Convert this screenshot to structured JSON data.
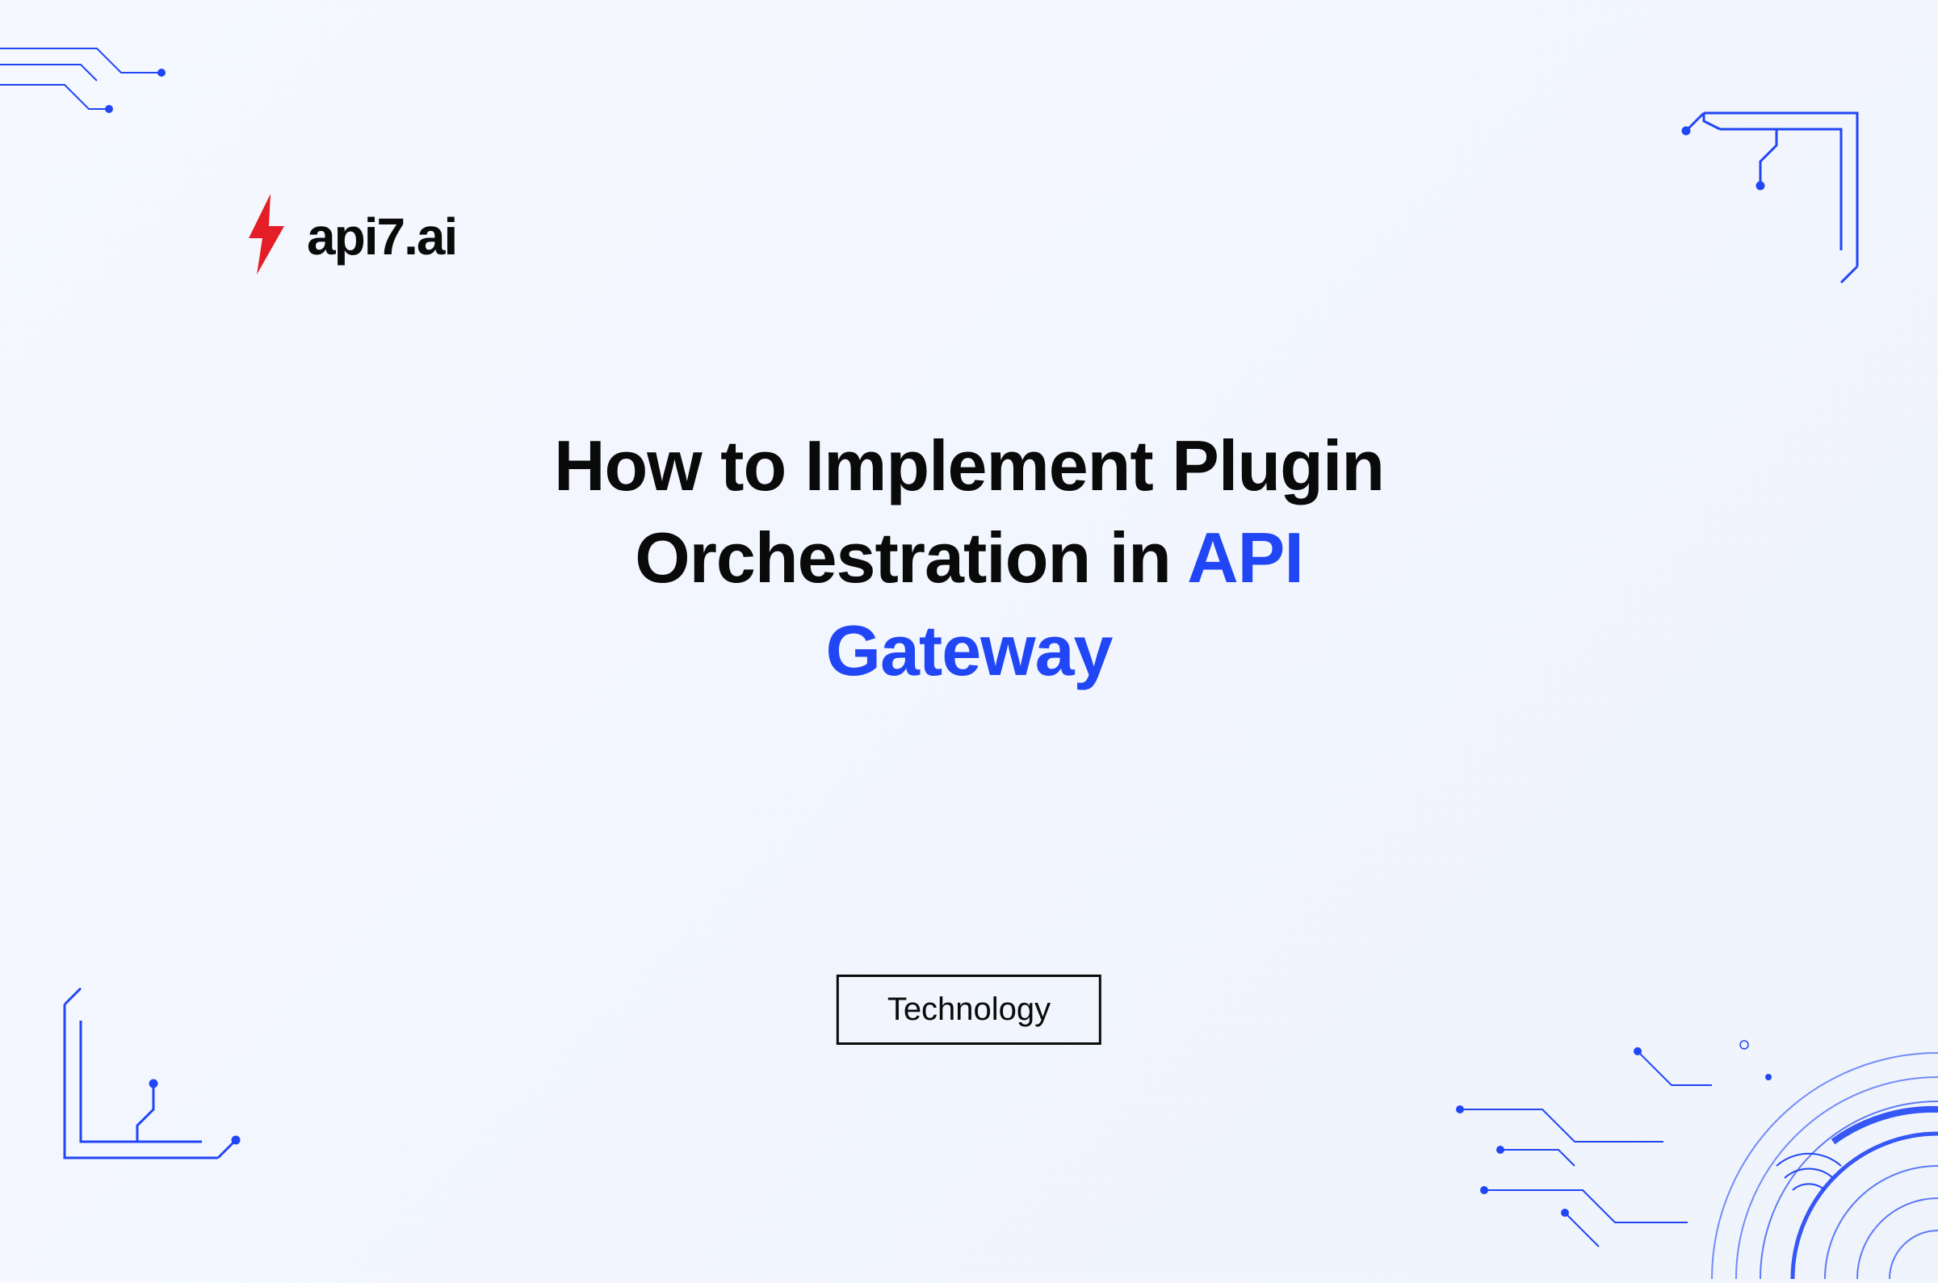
{
  "brand": {
    "name": "api7.ai",
    "logo_text": "aPI7.aI"
  },
  "title": {
    "line1": "How to Implement Plugin",
    "line2_plain": "Orchestration in ",
    "line2_highlight": "API",
    "line3_highlight": "Gateway"
  },
  "category": "Technology",
  "colors": {
    "accent": "#2046f5",
    "logo_red": "#e41e26",
    "text": "#0a0a0a"
  }
}
